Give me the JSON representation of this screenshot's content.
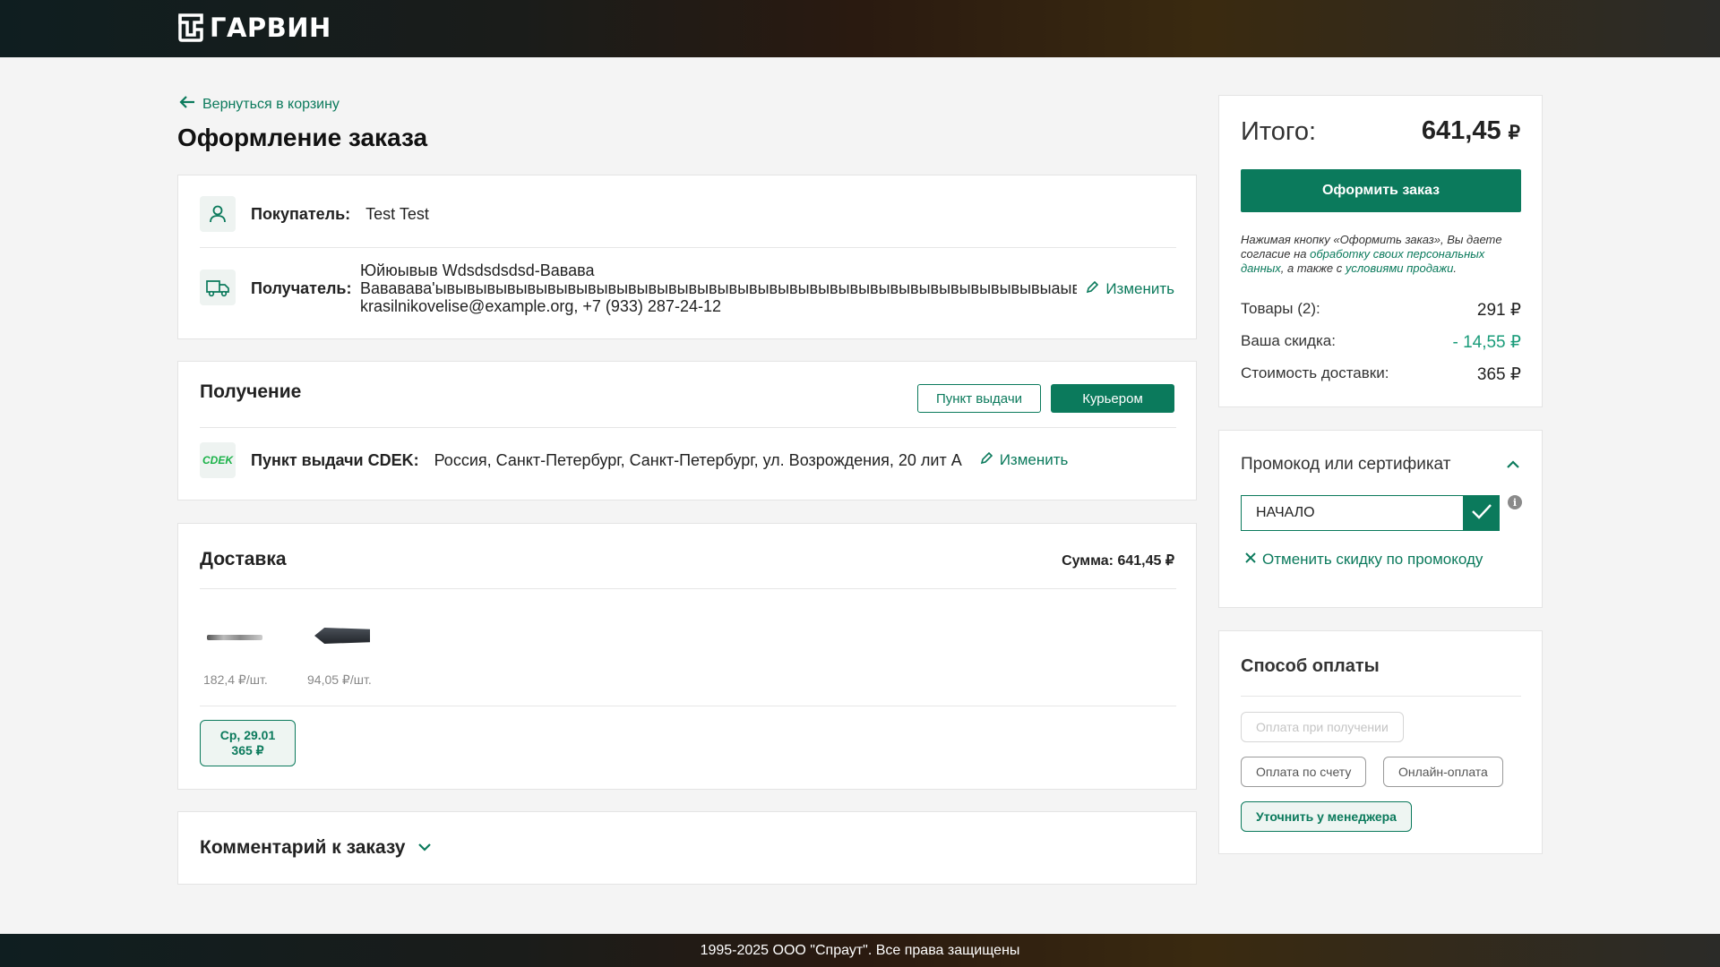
{
  "header": {
    "logo_text": "ГАРВИН"
  },
  "back_link": "Вернуться в корзину",
  "page_title": "Оформление заказа",
  "buyer": {
    "label": "Покупатель:",
    "value": "Test Test"
  },
  "recipient": {
    "label": "Получатель:",
    "line1": "Юйюывыв Wdsdsdsdsd-Вавава",
    "line2": "Вававава'ывывывывывывывывывывывывывывывывывывывывывывывывывывывывывывыаывывывыввв,",
    "line3": "krasilnikovelise@example.org, +7 (933) 287-24-12",
    "edit": "Изменить"
  },
  "receipt": {
    "title": "Получение",
    "option_pickup": "Пункт выдачи",
    "option_courier": "Курьером",
    "cdek_logo": "CDEK",
    "point_label": "Пункт выдачи CDEK:",
    "point_address": "Россия, Санкт-Петербург, Санкт-Петербург, ул. Возрождения, 20 лит А",
    "edit": "Изменить"
  },
  "delivery": {
    "title": "Доставка",
    "sum": "Сумма: 641,45 ₽",
    "items": [
      {
        "price": "182,4 ₽/шт."
      },
      {
        "price": "94,05 ₽/шт."
      }
    ],
    "slot_date": "Ср, 29.01",
    "slot_price": "365 ₽"
  },
  "comment": {
    "title": "Комментарий к заказу"
  },
  "summary": {
    "total_label": "Итого:",
    "total_value": "641,45",
    "currency": "₽",
    "submit": "Оформить заказ",
    "consent_1": "Нажимая кнопку «Оформить заказ», Вы даете согласие на",
    "consent_link1": "обработку своих персональных данных",
    "consent_2": ", а также с",
    "consent_link2": "условиями продажи",
    "consent_3": ".",
    "rows": [
      {
        "label": "Товары (2):",
        "value": "291 ₽"
      },
      {
        "label": "Ваша скидка:",
        "value": "- 14,55 ₽"
      },
      {
        "label": "Стоимость доставки:",
        "value": "365 ₽"
      }
    ]
  },
  "promo": {
    "title": "Промокод или сертификат",
    "value": "НАЧАЛО",
    "cancel": "Отменить скидку по промокоду"
  },
  "payment": {
    "title": "Способ оплаты",
    "options": [
      "Оплата при получении",
      "Оплата по счету",
      "Онлайн-оплата",
      "Уточнить у менеджера"
    ]
  },
  "footer": {
    "text": "1995-2025 ООО \"Спраут\". Все права защищены"
  },
  "colors": {
    "accent": "#0b7a5c",
    "discount": "#1a9c7a"
  }
}
